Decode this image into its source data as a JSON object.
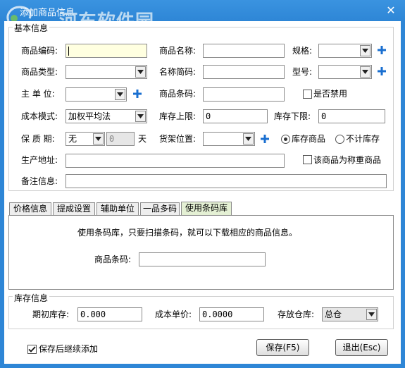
{
  "window": {
    "title": "添加商品信息",
    "close": "✕"
  },
  "watermark": {
    "text": "河东软件园",
    "url": "www.pc0359.cn"
  },
  "basic": {
    "title": "基本信息",
    "code_label": "商品编码:",
    "name_label": "商品名称:",
    "spec_label": "规格:",
    "type_label": "商品类型:",
    "shortname_label": "名称简码:",
    "model_label": "型号:",
    "unit_label": "主 单 位:",
    "barcode_label": "商品条码:",
    "disabled_label": "是否禁用",
    "cost_mode_label": "成本模式:",
    "cost_mode_value": "加权平均法",
    "stock_upper_label": "库存上限:",
    "stock_upper_value": "0",
    "stock_lower_label": "库存下限:",
    "stock_lower_value": "0",
    "shelf_life_label": "保 质 期:",
    "shelf_life_unit_value": "无",
    "shelf_life_value": "0",
    "day_label": "天",
    "shelf_pos_label": "货架位置:",
    "radio_stock_label": "库存商品",
    "radio_nostock_label": "不计库存",
    "address_label": "生产地址:",
    "weighing_label": "该商品为称重商品",
    "remark_label": "备注信息:"
  },
  "tabs": [
    {
      "label": "价格信息"
    },
    {
      "label": "提成设置"
    },
    {
      "label": "辅助单位"
    },
    {
      "label": "一品多码"
    },
    {
      "label": "使用条码库"
    }
  ],
  "barcode_panel": {
    "message": "使用条码库，只要扫描条码，就可以下载相应的商品信息。",
    "barcode_label": "商品条码:"
  },
  "stock": {
    "title": "库存信息",
    "initial_label": "期初库存:",
    "initial_value": "0.000",
    "unit_cost_label": "成本单价:",
    "unit_cost_value": "0.0000",
    "warehouse_label": "存放仓库:",
    "warehouse_value": "总仓"
  },
  "footer": {
    "continue_label": "保存后继续添加",
    "save_label": "保存(F5)",
    "exit_label": "退出(Esc)"
  },
  "colors": {
    "titlebar": "#2e86d6",
    "plus_icon": "#1a6fd0",
    "active_tab": "#e4f0d4"
  }
}
